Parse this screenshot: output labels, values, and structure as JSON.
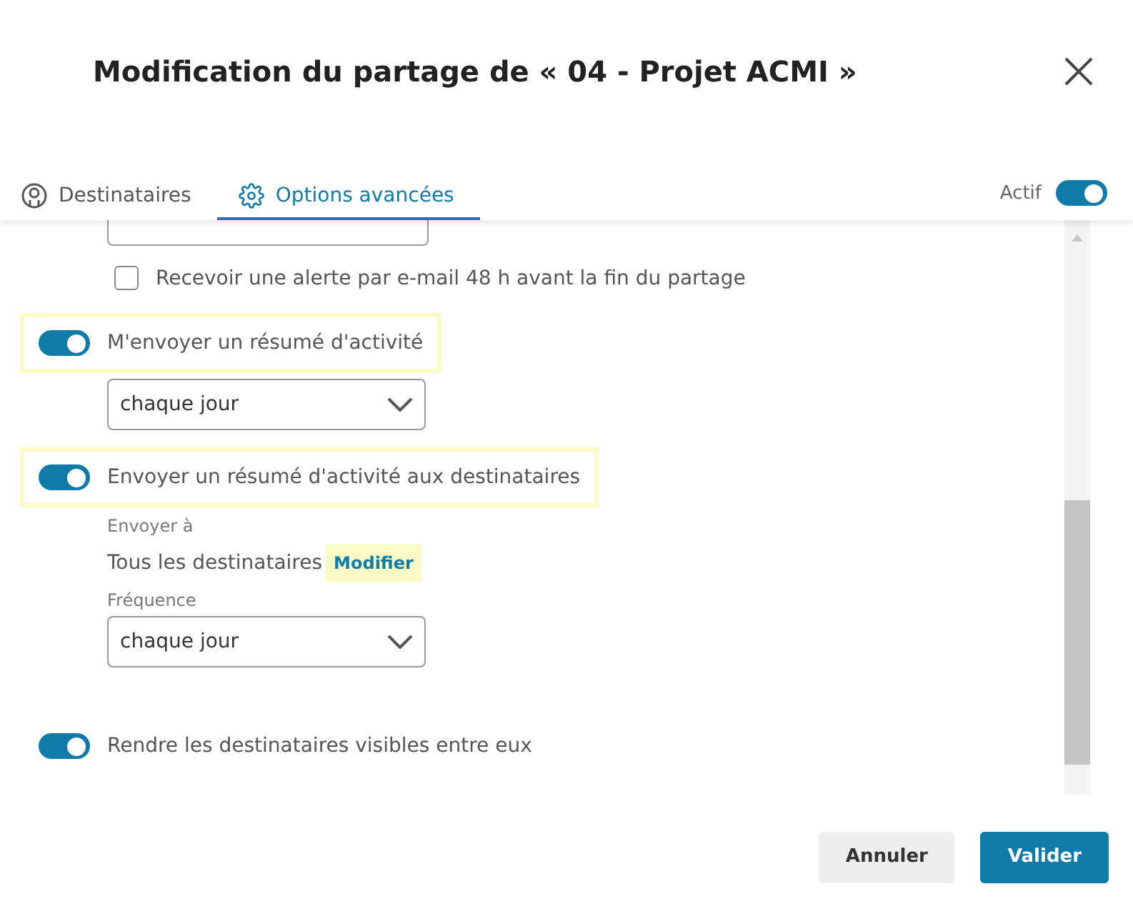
{
  "dialog": {
    "title": "Modification du partage de « 04 - Projet ACMI »"
  },
  "tabs": [
    {
      "label": "Destinataires",
      "selected": false
    },
    {
      "label": "Options avancées",
      "selected": true
    }
  ],
  "active": {
    "label": "Actif",
    "on": true
  },
  "options": [
    {
      "kind": "checkbox",
      "label": "Recevoir une alerte par e-mail 48 h avant la fin du partage",
      "checked": false
    },
    {
      "kind": "toggle",
      "label": "M'envoyer un résumé d'activité",
      "on": true,
      "highlighted": true,
      "select": "chaque jour"
    },
    {
      "kind": "toggle",
      "label": "Envoyer un résumé d'activité aux destinataires",
      "on": true,
      "highlighted": true,
      "send_to_label": "Envoyer à",
      "send_to": "Tous les destinataires",
      "modify": "Modifier",
      "frequency_label": "Fréquence",
      "select": "chaque jour"
    },
    {
      "kind": "toggle",
      "label": "Rendre les destinataires visibles entre eux",
      "on": true,
      "highlighted": false
    }
  ],
  "buttons": [
    {
      "label": "Annuler",
      "kind": "secondary"
    },
    {
      "label": "Valider",
      "kind": "primary"
    }
  ]
}
